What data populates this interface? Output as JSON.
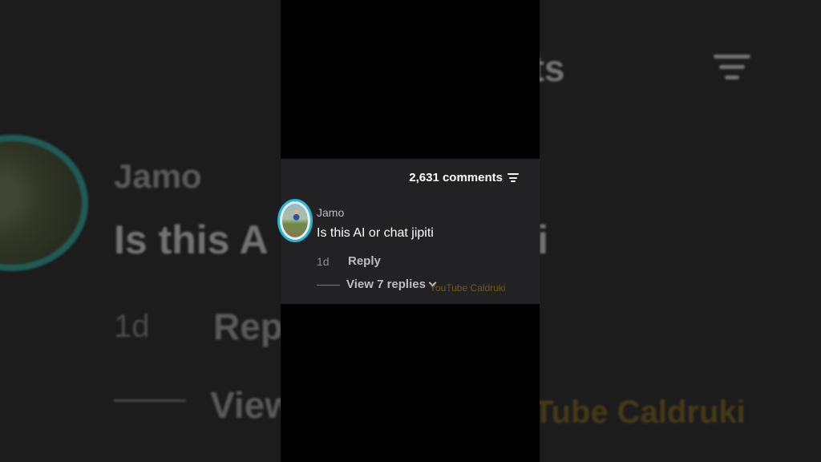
{
  "comments": {
    "count_label": "2,631 comments"
  },
  "comment": {
    "author": "Jamo",
    "text": "Is this AI or chat jipiti",
    "time": "1d",
    "reply_label": "Reply",
    "view_replies_label": "View 7 replies"
  },
  "watermark": "YouTube Caldruki",
  "background": {
    "count_partial": "omments",
    "text_partial": "Is this A",
    "text_tail": "iti",
    "reply_partial": "Rep",
    "view_partial": "View",
    "watermark_partial": "Tube Caldruki"
  },
  "icons": {
    "filter": "filter-icon",
    "chevron": "chevron-down-icon"
  },
  "colors": {
    "avatar_ring": "#21b5d6",
    "card_bg": "#222224",
    "watermark": "#6e5a1a"
  }
}
